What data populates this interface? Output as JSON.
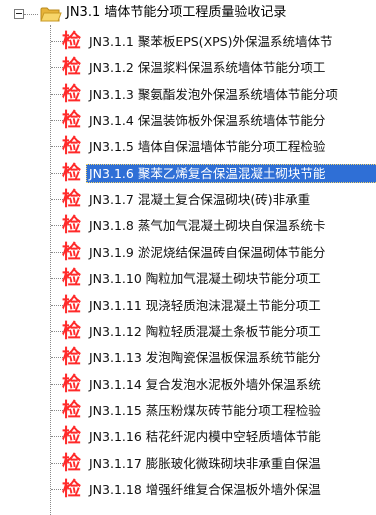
{
  "tree": {
    "root": {
      "label": "JN3.1 墙体节能分项工程质量验收记录",
      "expander": "minus-expander-icon",
      "icon": "folder-open-icon"
    },
    "item_icon_text": "检",
    "selected_index": 5,
    "items": [
      {
        "label": "JN3.1.1 聚苯板EPS(XPS)外保温系统墙体节"
      },
      {
        "label": "JN3.1.2 保温浆料保温系统墙体节能分项工"
      },
      {
        "label": "JN3.1.3 聚氨酯发泡外保温系统墙体节能分项"
      },
      {
        "label": "JN3.1.4 保温装饰板外保温系统墙体节能分"
      },
      {
        "label": "JN3.1.5 墙体自保温墙体节能分项工程检验"
      },
      {
        "label": "JN3.1.6 聚苯乙烯复合保温混凝土砌块节能"
      },
      {
        "label": "JN3.1.7 混凝土复合保温砌块(砖)非承重"
      },
      {
        "label": "JN3.1.8 蒸气加气混凝土砌块自保温系统卡"
      },
      {
        "label": "JN3.1.9 淤泥烧结保温砖自保温砌体节能分"
      },
      {
        "label": "JN3.1.10 陶粒加气混凝土砌块节能分项工"
      },
      {
        "label": "JN3.1.11 现浇轻质泡沫混凝土节能分项工"
      },
      {
        "label": "JN3.1.12 陶粒轻质混凝土条板节能分项工"
      },
      {
        "label": "JN3.1.13 发泡陶瓷保温板保温系统节能分"
      },
      {
        "label": "JN3.1.14 复合发泡水泥板外墙外保温系统"
      },
      {
        "label": "JN3.1.15 蒸压粉煤灰砖节能分项工程检验"
      },
      {
        "label": "JN3.1.16 秸花纤泥内模中空轻质墙体节能"
      },
      {
        "label": "JN3.1.17 膨胀玻化微珠砌块非承重自保温"
      },
      {
        "label": "JN3.1.18 增强纤维复合保温板外墙外保温"
      }
    ]
  }
}
